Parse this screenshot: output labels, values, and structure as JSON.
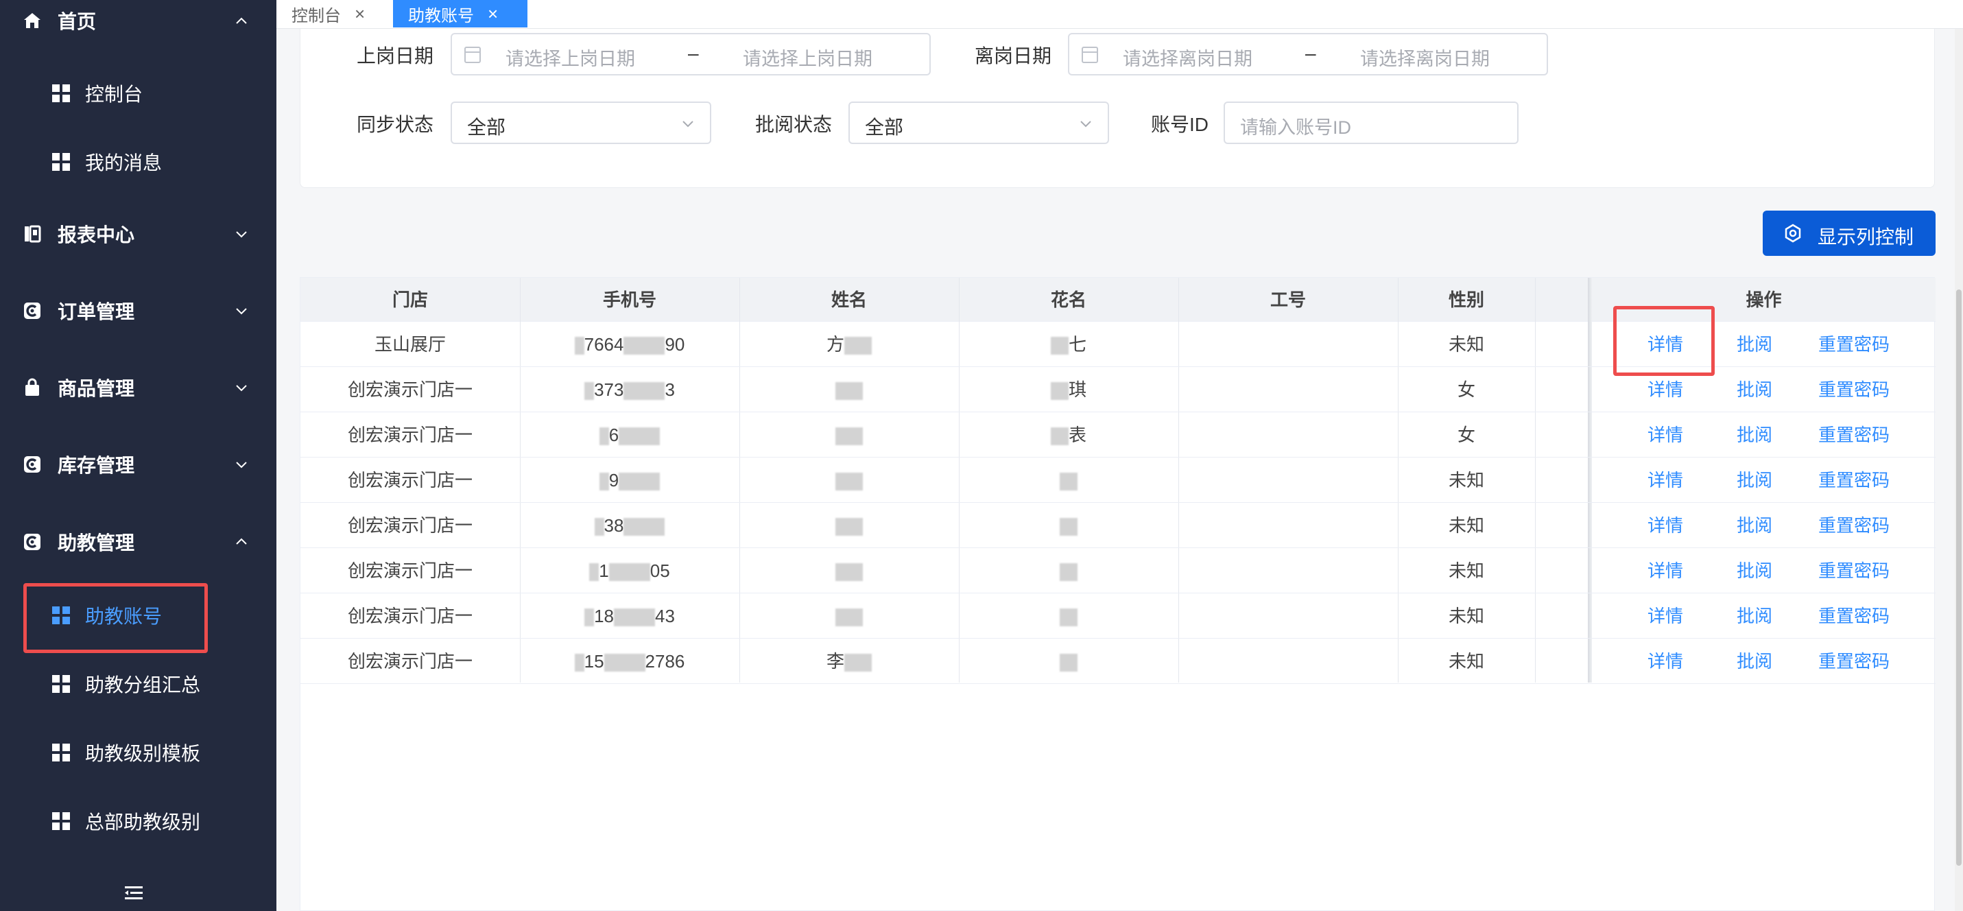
{
  "sidebar": {
    "groups": [
      {
        "label": "首页",
        "icon": "home-icon",
        "expanded": true
      },
      {
        "label": "报表中心",
        "icon": "report-icon",
        "expanded": false
      },
      {
        "label": "订单管理",
        "icon": "order-icon",
        "expanded": false
      },
      {
        "label": "商品管理",
        "icon": "goods-icon",
        "expanded": false
      },
      {
        "label": "库存管理",
        "icon": "inventory-icon",
        "expanded": false
      },
      {
        "label": "助教管理",
        "icon": "assistant-icon",
        "expanded": true
      }
    ],
    "home_children": [
      "控制台",
      "我的消息"
    ],
    "assistant_children": [
      "助教账号",
      "助教分组汇总",
      "助教级别模板",
      "总部助教级别"
    ],
    "active_item": "助教账号"
  },
  "tabs": [
    {
      "label": "控制台",
      "active": false
    },
    {
      "label": "助教账号",
      "active": true
    }
  ],
  "filters": {
    "onboard_label": "上岗日期",
    "onboard_start_placeholder": "请选择上岗日期",
    "onboard_end_placeholder": "请选择上岗日期",
    "leave_label": "离岗日期",
    "leave_start_placeholder": "请选择离岗日期",
    "leave_end_placeholder": "请选择离岗日期",
    "range_separator": "–",
    "sync_label": "同步状态",
    "sync_value": "全部",
    "review_label": "批阅状态",
    "review_value": "全部",
    "account_id_label": "账号ID",
    "account_id_placeholder": "请输入账号ID"
  },
  "toolbar": {
    "column_control_label": "显示列控制"
  },
  "table": {
    "columns": [
      "门店",
      "手机号",
      "姓名",
      "花名",
      "工号",
      "性别",
      "操作"
    ],
    "rows": [
      {
        "store": "玉山展厅",
        "phone": "7664",
        "phone_tail": "90",
        "name": "方",
        "alias": "七",
        "job_no": "",
        "gender": "未知"
      },
      {
        "store": "创宏演示门店一",
        "phone": "373",
        "phone_tail": "3",
        "name": "",
        "alias": "琪",
        "job_no": "",
        "gender": "女"
      },
      {
        "store": "创宏演示门店一",
        "phone": "6",
        "phone_tail": "",
        "name": "",
        "alias": "表",
        "job_no": "",
        "gender": "女"
      },
      {
        "store": "创宏演示门店一",
        "phone": "9",
        "phone_tail": "",
        "name": "",
        "alias": "",
        "job_no": "",
        "gender": "未知"
      },
      {
        "store": "创宏演示门店一",
        "phone": "38",
        "phone_tail": "",
        "name": "",
        "alias": "",
        "job_no": "",
        "gender": "未知"
      },
      {
        "store": "创宏演示门店一",
        "phone": "1",
        "phone_tail": "05",
        "name": "",
        "alias": "",
        "job_no": "",
        "gender": "未知"
      },
      {
        "store": "创宏演示门店一",
        "phone": "18",
        "phone_tail": "43",
        "name": "",
        "alias": "",
        "job_no": "",
        "gender": "未知"
      },
      {
        "store": "创宏演示门店一",
        "phone": "15",
        "phone_tail": "2786",
        "name": "李",
        "alias": "",
        "job_no": "",
        "gender": "未知"
      }
    ],
    "actions": {
      "detail": "详情",
      "review": "批阅",
      "reset_password": "重置密码"
    }
  }
}
